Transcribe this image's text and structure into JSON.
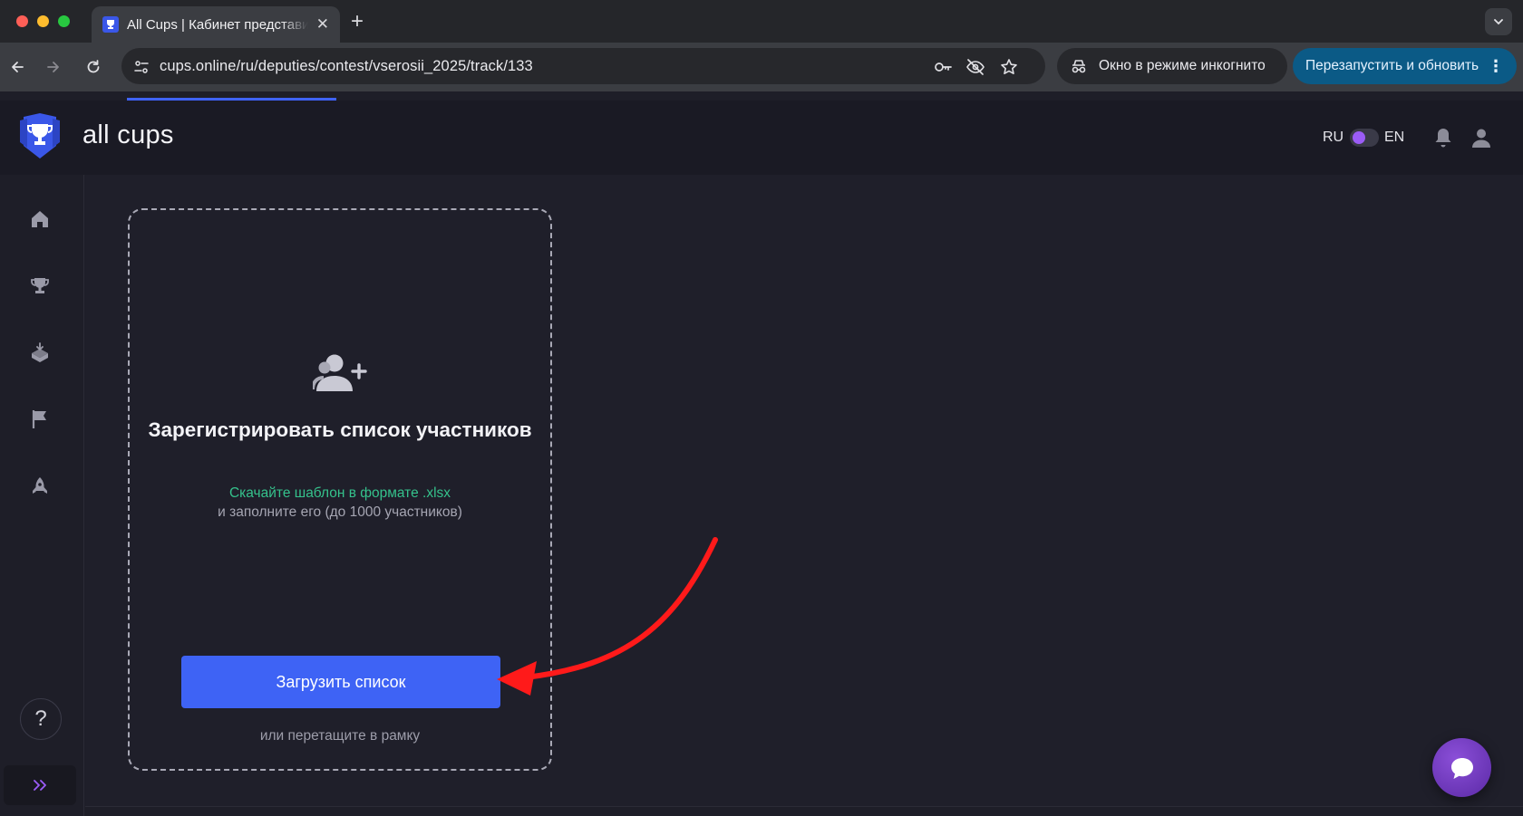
{
  "browser": {
    "tab_title": "All Cups | Кабинет представителя",
    "new_tab_symbol": "+",
    "close_symbol": "✕",
    "url": "cups.online/ru/deputies/contest/vserosii_2025/track/133",
    "incognito_label": "Окно в режиме инкогнито",
    "relaunch_label": "Перезапустить и обновить",
    "menu_symbol": "⋮"
  },
  "header": {
    "brand": "all cups",
    "lang_left": "RU",
    "lang_right": "EN",
    "lang_toggle_state": "RU"
  },
  "sidebar": {
    "items": [
      {
        "icon": "home-icon"
      },
      {
        "icon": "trophy-icon"
      },
      {
        "icon": "box-download-icon"
      },
      {
        "icon": "flag-icon"
      },
      {
        "icon": "rocket-icon"
      }
    ],
    "help_label": "?",
    "expand_label": "»"
  },
  "upload": {
    "title": "Зарегистрировать список участников",
    "template_link": "Скачайте шаблон в формате .xlsx",
    "hint": "и заполните его (до 1000 участников)",
    "button_label": "Загрузить список",
    "drag_hint": "или перетащите в рамку"
  },
  "colors": {
    "accent": "#3e63f5",
    "link": "#35c28c",
    "toggle": "#9b5cf6",
    "annotation": "#ff1a1a",
    "chat": "#7a3fc8"
  }
}
